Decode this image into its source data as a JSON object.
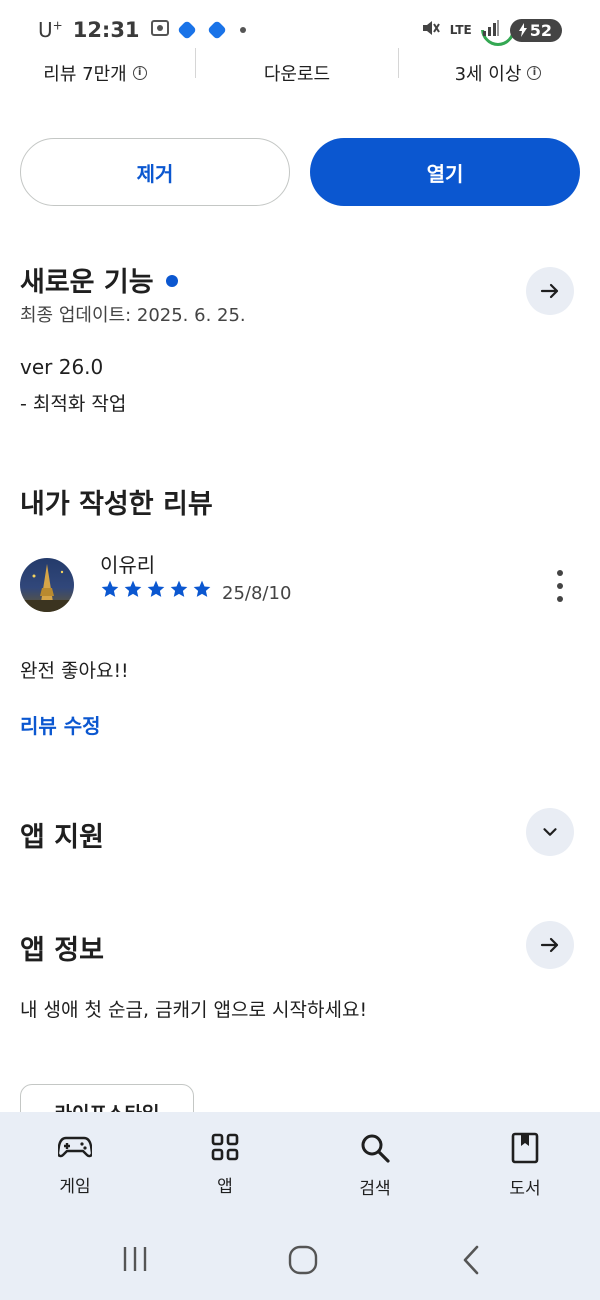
{
  "status_bar": {
    "carrier": "U",
    "carrier_sup": "+",
    "time": "12:31",
    "network": "LTE",
    "battery": "52"
  },
  "stats": {
    "reviews_label": "리뷰 7만개",
    "downloads_label": "다운로드",
    "age_label": "3세 이상"
  },
  "actions": {
    "remove_label": "제거",
    "open_label": "열기"
  },
  "whats_new": {
    "title": "새로운 기능",
    "updated": "최종 업데이트: 2025. 6. 25.",
    "version": "ver 26.0",
    "note": "- 최적화 작업"
  },
  "my_review": {
    "title": "내가 작성한 리뷰",
    "reviewer": "이유리",
    "rating": 5,
    "date": "25/8/10",
    "body": "완전 좋아요!!",
    "edit_label": "리뷰 수정"
  },
  "app_support": {
    "title": "앱 지원"
  },
  "app_info": {
    "title": "앱 정보",
    "description": "내 생애 첫 순금, 금캐기 앱으로 시작하세요!",
    "category_chip": "라이프스타일"
  },
  "bottom_nav": [
    {
      "label": "게임",
      "icon": "gamepad-icon"
    },
    {
      "label": "앱",
      "icon": "apps-grid-icon"
    },
    {
      "label": "검색",
      "icon": "search-icon"
    },
    {
      "label": "도서",
      "icon": "book-icon"
    }
  ],
  "colors": {
    "accent": "#0b57d0",
    "nav_bg": "#e9eef6",
    "round_btn_bg": "#e9edf4"
  }
}
